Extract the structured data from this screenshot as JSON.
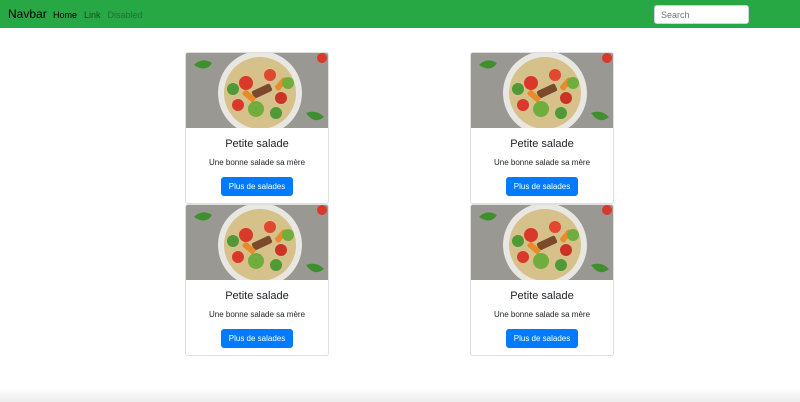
{
  "navbar": {
    "brand": "Navbar",
    "links": [
      {
        "label": "Home",
        "state": "active"
      },
      {
        "label": "Link",
        "state": "normal"
      },
      {
        "label": "Disabled",
        "state": "disabled"
      }
    ],
    "search_placeholder": "Search"
  },
  "cards": [
    {
      "image_icon": "salad-photo",
      "title": "Petite salade",
      "text": "Une bonne salade sa mère",
      "button": "Plus de salades"
    },
    {
      "image_icon": "salad-photo",
      "title": "Petite salade",
      "text": "Une bonne salade sa mère",
      "button": "Plus de salades"
    },
    {
      "image_icon": "salad-photo",
      "title": "Petite salade",
      "text": "Une bonne salade sa mère",
      "button": "Plus de salades"
    },
    {
      "image_icon": "salad-photo",
      "title": "Petite salade",
      "text": "Une bonne salade sa mère",
      "button": "Plus de salades"
    }
  ],
  "colors": {
    "navbar_bg": "#28a745",
    "button_bg": "#007bff",
    "card_border": "rgba(0,0,0,0.125)"
  }
}
